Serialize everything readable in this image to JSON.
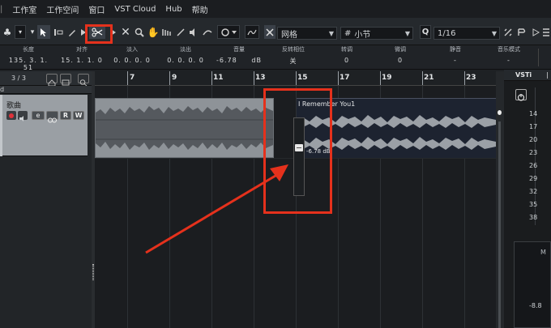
{
  "menu": [
    "工作室",
    "工作空间",
    "窗口",
    "VST Cloud",
    "Hub",
    "帮助"
  ],
  "toolbar": {
    "snap_type": "网格",
    "grid_type": "小节",
    "quantize": "1/16",
    "quantize_icon": "Q"
  },
  "info": [
    {
      "label": "长度",
      "value": "135. 3. 1. 51"
    },
    {
      "label": "对齐",
      "value": "15. 1. 1. 0"
    },
    {
      "label": "淡入",
      "value": "0. 0. 0. 0"
    },
    {
      "label": "淡出",
      "value": "0. 0. 0. 0"
    },
    {
      "label": "音量",
      "value": "-6.78",
      "unit": "dB"
    },
    {
      "label": "反转相位",
      "value": "关"
    },
    {
      "label": "转调",
      "value": "0"
    },
    {
      "label": "微调",
      "value": "0"
    },
    {
      "label": "静音",
      "value": "-"
    },
    {
      "label": "音乐模式",
      "value": "-"
    }
  ],
  "track": {
    "counter": "3 / 3",
    "name": "歌曲",
    "buttons": [
      "e",
      "R",
      "W"
    ]
  },
  "ruler": [
    "7",
    "9",
    "11",
    "13",
    "15",
    "17",
    "19",
    "21",
    "23"
  ],
  "events": {
    "right_name": "I Remember You1",
    "volume_readout": "-6.78 dB"
  },
  "vsti": {
    "tab": "VSTi",
    "scale": [
      "14",
      "17",
      "20",
      "23",
      "26",
      "29",
      "32",
      "35",
      "38"
    ],
    "readout": "-8.8"
  },
  "colors": {
    "accent": "#e5311c",
    "wave": "#9a9fa4",
    "event_right": "#1d2330"
  }
}
